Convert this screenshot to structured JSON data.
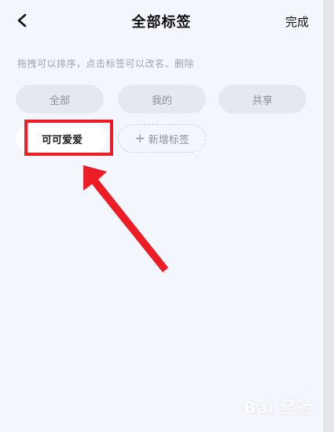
{
  "header": {
    "title": "全部标签",
    "done_label": "完成"
  },
  "hint": "拖拽可以排序，点击标签可以改名、删除",
  "fixed_tags": [
    "全部",
    "我的",
    "共享"
  ],
  "user_tags": [
    "可可爱爱"
  ],
  "add_tag_label": "新增标签",
  "watermark": "Bai 经验",
  "colors": {
    "background": "#f4f6fd",
    "fixed_tag_bg": "#e6e8ef",
    "annotation_red": "#ee1c25"
  },
  "icons": {
    "back": "chevron-left-icon",
    "add": "plus-icon"
  }
}
